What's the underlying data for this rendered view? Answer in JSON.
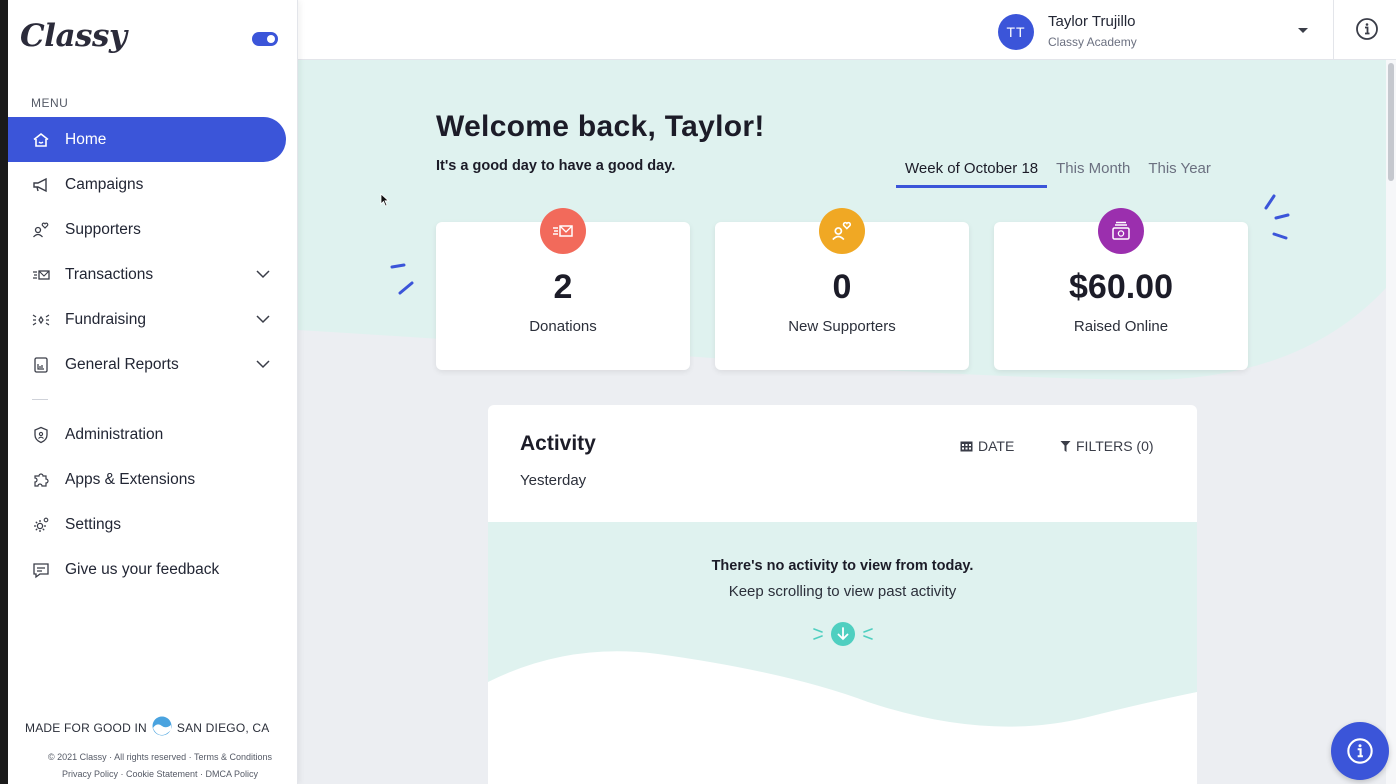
{
  "app": {
    "logo_text": "Classy"
  },
  "sidebar": {
    "menu_label": "MENU",
    "items": [
      {
        "label": "Home",
        "icon": "home-icon",
        "active": true
      },
      {
        "label": "Campaigns",
        "icon": "megaphone-icon"
      },
      {
        "label": "Supporters",
        "icon": "supporter-heart-icon"
      },
      {
        "label": "Transactions",
        "icon": "transaction-card-icon",
        "expandable": true
      },
      {
        "label": "Fundraising",
        "icon": "fundraising-burst-icon",
        "expandable": true
      },
      {
        "label": "General Reports",
        "icon": "report-icon",
        "expandable": true
      },
      {
        "label": "Administration",
        "icon": "shield-icon"
      },
      {
        "label": "Apps & Extensions",
        "icon": "puzzle-icon"
      },
      {
        "label": "Settings",
        "icon": "gear-icon"
      },
      {
        "label": "Give us your feedback",
        "icon": "feedback-icon"
      }
    ],
    "footer": {
      "made_for_good": "MADE FOR GOOD IN",
      "location": "SAN DIEGO, CA",
      "legal_line1": "© 2021 Classy · All rights reserved · Terms & Conditions",
      "legal_line2": "Privacy Policy · Cookie Statement · DMCA Policy"
    }
  },
  "header": {
    "avatar_initials": "TT",
    "user_name": "Taylor Trujillo",
    "user_org": "Classy Academy"
  },
  "main": {
    "welcome": "Welcome back, Taylor!",
    "subtitle": "It's a good day to have a good day.",
    "tabs": [
      {
        "label": "Week of October 18",
        "active": true
      },
      {
        "label": "This Month"
      },
      {
        "label": "This Year"
      }
    ],
    "stats": [
      {
        "value": "2",
        "label": "Donations",
        "color": "#f26a5b",
        "icon": "donation-icon"
      },
      {
        "value": "0",
        "label": "New Supporters",
        "color": "#f0a824",
        "icon": "supporter-heart-icon"
      },
      {
        "value": "$60.00",
        "label": "Raised Online",
        "color": "#9b2fae",
        "icon": "money-icon"
      }
    ],
    "activity": {
      "title": "Activity",
      "period": "Yesterday",
      "date_label": "DATE",
      "filters_label": "FILTERS (0)",
      "empty_title": "There's no activity to view from today.",
      "empty_sub": "Keep scrolling to view past activity"
    }
  },
  "colors": {
    "accent": "#3b55d9",
    "teal_bg": "#dff2ef",
    "teal_arrow": "#4fcfc0"
  }
}
